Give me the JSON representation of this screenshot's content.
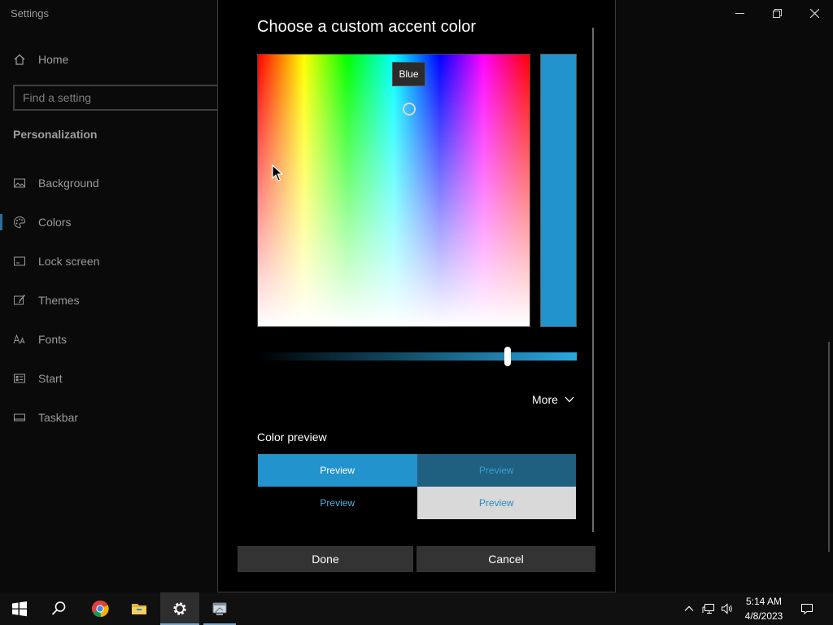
{
  "window": {
    "app_title": "Settings",
    "minimize_icon": "minimize-icon",
    "restore_icon": "restore-icon",
    "close_icon": "close-icon"
  },
  "sidebar": {
    "home": {
      "label": "Home",
      "icon": "home-icon"
    },
    "search": {
      "placeholder": "Find a setting",
      "value": ""
    },
    "section_title": "Personalization",
    "items": [
      {
        "label": "Background",
        "icon": "image-icon",
        "selected": false
      },
      {
        "label": "Colors",
        "icon": "palette-icon",
        "selected": true
      },
      {
        "label": "Lock screen",
        "icon": "lock-screen-icon",
        "selected": false
      },
      {
        "label": "Themes",
        "icon": "themes-icon",
        "selected": false
      },
      {
        "label": "Fonts",
        "icon": "fonts-icon",
        "selected": false
      },
      {
        "label": "Start",
        "icon": "start-icon",
        "selected": false
      },
      {
        "label": "Taskbar",
        "icon": "taskbar-icon",
        "selected": false
      }
    ]
  },
  "dialog": {
    "title": "Choose a custom accent color",
    "picker": {
      "tooltip": "Blue",
      "selected_color": "#2293cc"
    },
    "value_slider": {
      "level": 0.79,
      "start_color": "#000000",
      "end_color": "#2aa8e2"
    },
    "more": {
      "label": "More",
      "icon": "chevron-down-icon"
    },
    "preview": {
      "heading": "Color preview",
      "cells": [
        {
          "label": "Preview",
          "bg": "#2293cc",
          "fg": "#ffffff"
        },
        {
          "label": "Preview",
          "bg": "#1f5f80",
          "fg": "#3c9ecf"
        },
        {
          "label": "Preview",
          "bg": "#000000",
          "fg": "#55aee0"
        },
        {
          "label": "Preview",
          "bg": "#d9d9d9",
          "fg": "#2a8bc0"
        }
      ]
    },
    "buttons": {
      "done": "Done",
      "cancel": "Cancel"
    }
  },
  "taskbar": {
    "apps": [
      {
        "name": "start",
        "icon": "windows-icon"
      },
      {
        "name": "search",
        "icon": "search-icon"
      },
      {
        "name": "chrome",
        "icon": "chrome-icon"
      },
      {
        "name": "file-explorer",
        "icon": "folder-icon"
      },
      {
        "name": "settings",
        "icon": "gear-icon",
        "active": true
      },
      {
        "name": "app",
        "icon": "app-window-icon",
        "open": true
      }
    ],
    "tray": {
      "icons": [
        "chevron-up-icon",
        "network-icon",
        "volume-icon"
      ],
      "time": "5:14 AM",
      "date": "4/8/2023",
      "notification_icon": "notification-icon"
    }
  }
}
